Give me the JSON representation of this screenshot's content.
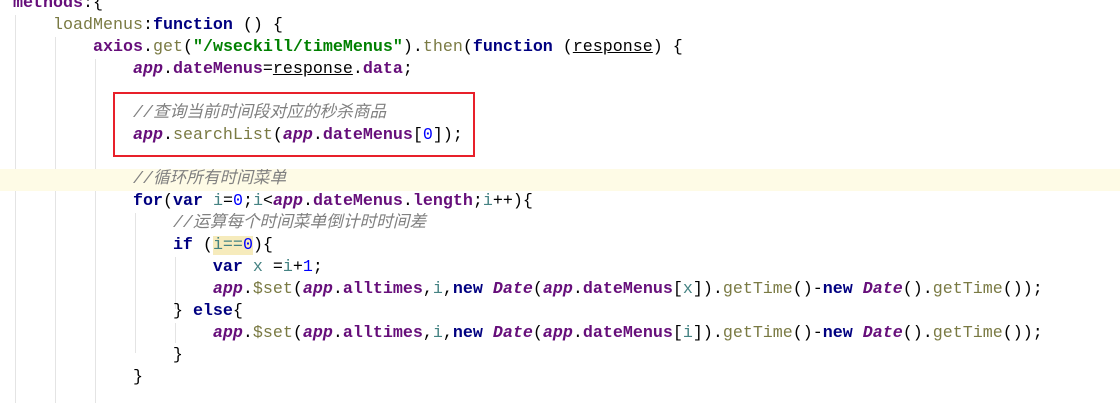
{
  "editor": {
    "highlight_box_color": "#e8202a",
    "lines": [
      [
        [
          "methods",
          "prop"
        ],
        [
          ":{",
          "pl"
        ]
      ],
      [
        [
          "    ",
          "pl"
        ],
        [
          "loadMenus",
          "fn"
        ],
        [
          ":",
          "pl"
        ],
        [
          "function",
          "kw"
        ],
        [
          " () {",
          "pl"
        ]
      ],
      [
        [
          "        ",
          "pl"
        ],
        [
          "axios",
          "prop"
        ],
        [
          ".",
          "pl"
        ],
        [
          "get",
          "fn"
        ],
        [
          "(",
          "pl"
        ],
        [
          "\"/wseckill/timeMenus\"",
          "str"
        ],
        [
          ").",
          "pl"
        ],
        [
          "then",
          "fn"
        ],
        [
          "(",
          "pl"
        ],
        [
          "function",
          "kw"
        ],
        [
          " (",
          "pl"
        ],
        [
          "response",
          "ul"
        ],
        [
          ") {",
          "pl"
        ]
      ],
      [
        [
          "            ",
          "pl"
        ],
        [
          "app",
          "glob"
        ],
        [
          ".",
          "pl"
        ],
        [
          "dateMenus",
          "prop"
        ],
        [
          "=",
          "pl"
        ],
        [
          "response",
          "ul"
        ],
        [
          ".",
          "pl"
        ],
        [
          "data",
          "prop"
        ],
        [
          ";",
          "pl"
        ]
      ],
      [],
      [
        [
          "            ",
          "pl"
        ],
        [
          "//查询当前时间段对应的秒杀商品",
          "cmt"
        ]
      ],
      [
        [
          "            ",
          "pl"
        ],
        [
          "app",
          "glob"
        ],
        [
          ".",
          "pl"
        ],
        [
          "searchList",
          "fn"
        ],
        [
          "(",
          "pl"
        ],
        [
          "app",
          "glob"
        ],
        [
          ".",
          "pl"
        ],
        [
          "dateMenus",
          "prop"
        ],
        [
          "[",
          "pl"
        ],
        [
          "0",
          "num"
        ],
        [
          "]);",
          "pl"
        ]
      ],
      [],
      [
        [
          "            ",
          "pl"
        ],
        [
          "//循环所有时间菜单",
          "cmt"
        ]
      ],
      [
        [
          "            ",
          "pl"
        ],
        [
          "for",
          "kw"
        ],
        [
          "(",
          "pl"
        ],
        [
          "var",
          "kw"
        ],
        [
          " ",
          "pl"
        ],
        [
          "i",
          "var"
        ],
        [
          "=",
          "pl"
        ],
        [
          "0",
          "num"
        ],
        [
          ";",
          "pl"
        ],
        [
          "i",
          "var"
        ],
        [
          "<",
          "pl"
        ],
        [
          "app",
          "glob"
        ],
        [
          ".",
          "pl"
        ],
        [
          "dateMenus",
          "prop"
        ],
        [
          ".",
          "pl"
        ],
        [
          "length",
          "prop"
        ],
        [
          ";",
          "pl"
        ],
        [
          "i",
          "var"
        ],
        [
          "++){",
          "pl"
        ]
      ],
      [
        [
          "                ",
          "pl"
        ],
        [
          "//运算每个时间菜单倒计时时间差",
          "cmt"
        ]
      ],
      [
        [
          "                ",
          "pl"
        ],
        [
          "if",
          "kw"
        ],
        [
          " (",
          "pl"
        ],
        [
          "i==",
          "hl var"
        ],
        [
          "0",
          "hl num"
        ],
        [
          "){",
          "pl"
        ]
      ],
      [
        [
          "                    ",
          "pl"
        ],
        [
          "var",
          "kw"
        ],
        [
          " ",
          "pl"
        ],
        [
          "x",
          "var"
        ],
        [
          " =",
          "pl"
        ],
        [
          "i",
          "var"
        ],
        [
          "+",
          "pl"
        ],
        [
          "1",
          "num"
        ],
        [
          ";",
          "pl"
        ]
      ],
      [
        [
          "                    ",
          "pl"
        ],
        [
          "app",
          "glob"
        ],
        [
          ".",
          "pl"
        ],
        [
          "$set",
          "fn"
        ],
        [
          "(",
          "pl"
        ],
        [
          "app",
          "glob"
        ],
        [
          ".",
          "pl"
        ],
        [
          "alltimes",
          "prop"
        ],
        [
          ",",
          "pl"
        ],
        [
          "i",
          "var"
        ],
        [
          ",",
          "pl"
        ],
        [
          "new",
          "kw"
        ],
        [
          " ",
          "pl"
        ],
        [
          "Date",
          "glob"
        ],
        [
          "(",
          "pl"
        ],
        [
          "app",
          "glob"
        ],
        [
          ".",
          "pl"
        ],
        [
          "dateMenus",
          "prop"
        ],
        [
          "[",
          "pl"
        ],
        [
          "x",
          "var"
        ],
        [
          "]).",
          "pl"
        ],
        [
          "getTime",
          "fn"
        ],
        [
          "()-",
          "pl"
        ],
        [
          "new",
          "kw"
        ],
        [
          " ",
          "pl"
        ],
        [
          "Date",
          "glob"
        ],
        [
          "().",
          "pl"
        ],
        [
          "getTime",
          "fn"
        ],
        [
          "());",
          "pl"
        ]
      ],
      [
        [
          "                ",
          "pl"
        ],
        [
          "} ",
          "pl"
        ],
        [
          "else",
          "kw"
        ],
        [
          "{",
          "pl"
        ]
      ],
      [
        [
          "                    ",
          "pl"
        ],
        [
          "app",
          "glob"
        ],
        [
          ".",
          "pl"
        ],
        [
          "$set",
          "fn"
        ],
        [
          "(",
          "pl"
        ],
        [
          "app",
          "glob"
        ],
        [
          ".",
          "pl"
        ],
        [
          "alltimes",
          "prop"
        ],
        [
          ",",
          "pl"
        ],
        [
          "i",
          "var"
        ],
        [
          ",",
          "pl"
        ],
        [
          "new",
          "kw"
        ],
        [
          " ",
          "pl"
        ],
        [
          "Date",
          "glob"
        ],
        [
          "(",
          "pl"
        ],
        [
          "app",
          "glob"
        ],
        [
          ".",
          "pl"
        ],
        [
          "dateMenus",
          "prop"
        ],
        [
          "[",
          "pl"
        ],
        [
          "i",
          "var"
        ],
        [
          "]).",
          "pl"
        ],
        [
          "getTime",
          "fn"
        ],
        [
          "()-",
          "pl"
        ],
        [
          "new",
          "kw"
        ],
        [
          " ",
          "pl"
        ],
        [
          "Date",
          "glob"
        ],
        [
          "().",
          "pl"
        ],
        [
          "getTime",
          "fn"
        ],
        [
          "());",
          "pl"
        ]
      ],
      [
        [
          "                }",
          "pl"
        ]
      ],
      [
        [
          "            }",
          "pl"
        ]
      ],
      []
    ]
  }
}
